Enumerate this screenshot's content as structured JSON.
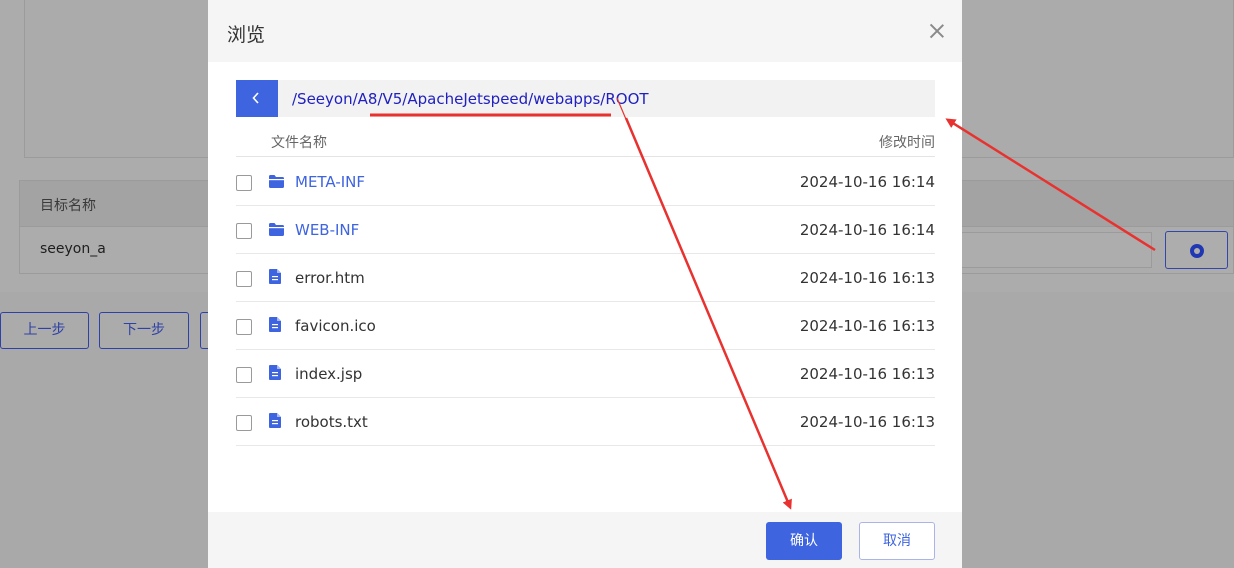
{
  "background": {
    "table_header": "目标名称",
    "table_value": "seeyon_a",
    "prev_button": "上一步",
    "next_button": "下一步"
  },
  "dialog": {
    "title": "浏览",
    "path": "/Seeyon/A8/V5/ApacheJetspeed/webapps/ROOT",
    "columns": {
      "name": "文件名称",
      "modified": "修改时间"
    },
    "files": [
      {
        "name": "META-INF",
        "type": "folder",
        "modified": "2024-10-16 16:14"
      },
      {
        "name": "WEB-INF",
        "type": "folder",
        "modified": "2024-10-16 16:14"
      },
      {
        "name": "error.htm",
        "type": "file",
        "modified": "2024-10-16 16:13"
      },
      {
        "name": "favicon.ico",
        "type": "file",
        "modified": "2024-10-16 16:13"
      },
      {
        "name": "index.jsp",
        "type": "file",
        "modified": "2024-10-16 16:13"
      },
      {
        "name": "robots.txt",
        "type": "file",
        "modified": "2024-10-16 16:13"
      }
    ],
    "confirm_label": "确认",
    "cancel_label": "取消"
  },
  "colors": {
    "accent": "#3e64e0",
    "path_text": "#2020c0",
    "annotation": "#e8322f"
  }
}
